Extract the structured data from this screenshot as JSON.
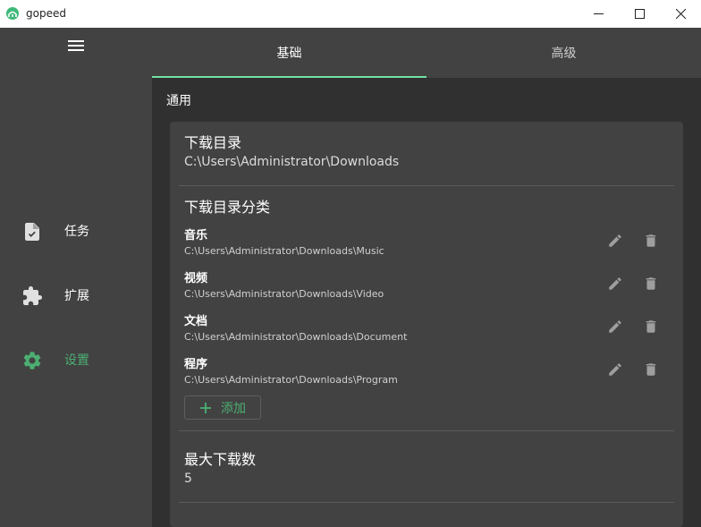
{
  "window": {
    "title": "gopeed"
  },
  "sidebar": {
    "items": [
      {
        "label": "任务",
        "icon": "task-file-icon"
      },
      {
        "label": "扩展",
        "icon": "puzzle-icon"
      },
      {
        "label": "设置",
        "icon": "gear-icon",
        "active": true
      }
    ]
  },
  "tabs": [
    {
      "label": "基础",
      "active": true
    },
    {
      "label": "高级",
      "active": false
    }
  ],
  "general": {
    "section_title": "通用",
    "download_dir": {
      "title": "下载目录",
      "value": "C:\\Users\\Administrator\\Downloads"
    },
    "categories": {
      "title": "下载目录分类",
      "items": [
        {
          "name": "音乐",
          "path": "C:\\Users\\Administrator\\Downloads\\Music"
        },
        {
          "name": "视频",
          "path": "C:\\Users\\Administrator\\Downloads\\Video"
        },
        {
          "name": "文档",
          "path": "C:\\Users\\Administrator\\Downloads\\Document"
        },
        {
          "name": "程序",
          "path": "C:\\Users\\Administrator\\Downloads\\Program"
        }
      ],
      "add_label": "添加"
    },
    "max_downloads": {
      "title": "最大下载数",
      "value": "5"
    }
  },
  "colors": {
    "accent": "#4caf72",
    "tab_indicator": "#73e2a4",
    "sidebar_bg": "#424242",
    "content_bg": "#303030",
    "card_bg": "#424242"
  }
}
